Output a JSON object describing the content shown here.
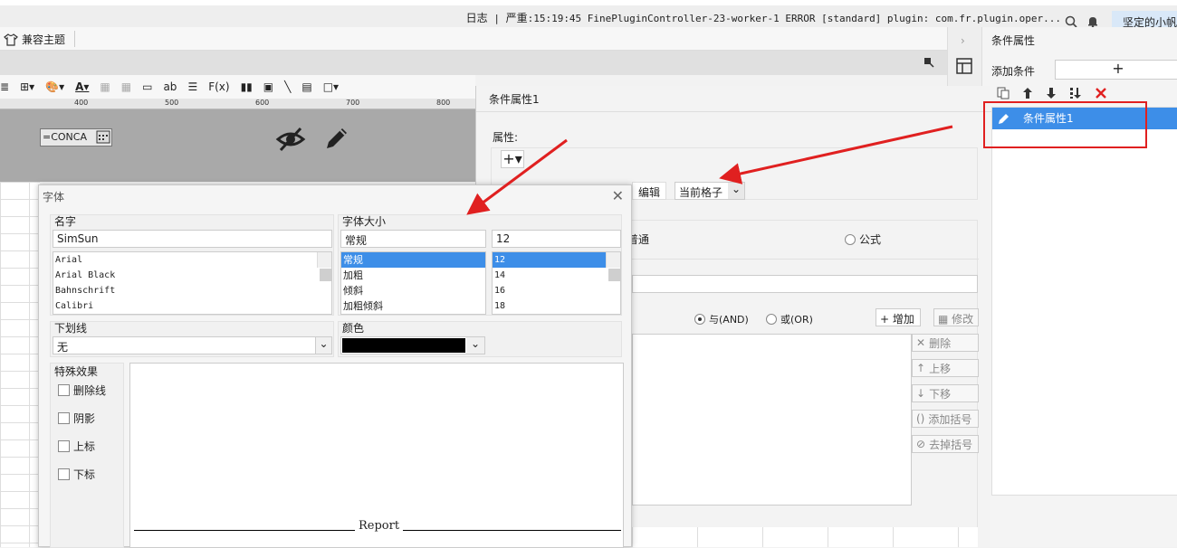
{
  "status": {
    "log_label": "日志",
    "divider": "|",
    "severity_label": "严重",
    "message": ":15:19:45 FinePluginController-23-worker-1 ERROR [standard] plugin: com.fr.plugin.oper...",
    "user_name": "坚定的小帆"
  },
  "menubar": {
    "theme_label": "兼容主题"
  },
  "ruler": {
    "ticks": [
      "400",
      "500",
      "600",
      "700",
      "800"
    ]
  },
  "canvas": {
    "formula_text": "=CONCA"
  },
  "toolbar": {
    "text_ab": "ab",
    "text_fx": "F(x)"
  },
  "cond_panel": {
    "title": "条件属性",
    "add_condition_label": "添加条件",
    "add_button": "+",
    "item_label": "条件属性1"
  },
  "cond_dialog": {
    "title": "条件属性1",
    "attr_label": "属性:",
    "edit_button": "编辑",
    "scope_value": "当前格子",
    "radio_normal": "普通",
    "radio_formula": "公式",
    "radio_and": "与(AND)",
    "radio_or": "或(OR)",
    "btn_add": "增加",
    "btn_modify": "修改",
    "btn_delete": "删除",
    "btn_up": "上移",
    "btn_down": "下移",
    "btn_add_bracket": "添加括号",
    "btn_remove_bracket": "去掉括号"
  },
  "font_dialog": {
    "title": "字体",
    "name_label": "名字",
    "name_value": "SimSun",
    "fonts": [
      "Arial",
      "Arial Black",
      "Bahnschrift",
      "Calibri"
    ],
    "size_group_label": "字体大小",
    "style_value": "常规",
    "styles": [
      "常规",
      "加粗",
      "倾斜",
      "加粗倾斜"
    ],
    "size_value": "12",
    "sizes": [
      "12",
      "14",
      "16",
      "18"
    ],
    "underline_label": "下划线",
    "underline_value": "无",
    "color_label": "颜色",
    "color_value": "#000000",
    "effects_label": "特殊效果",
    "effects": [
      "删除线",
      "阴影",
      "上标",
      "下标"
    ],
    "preview_text": "Report"
  }
}
